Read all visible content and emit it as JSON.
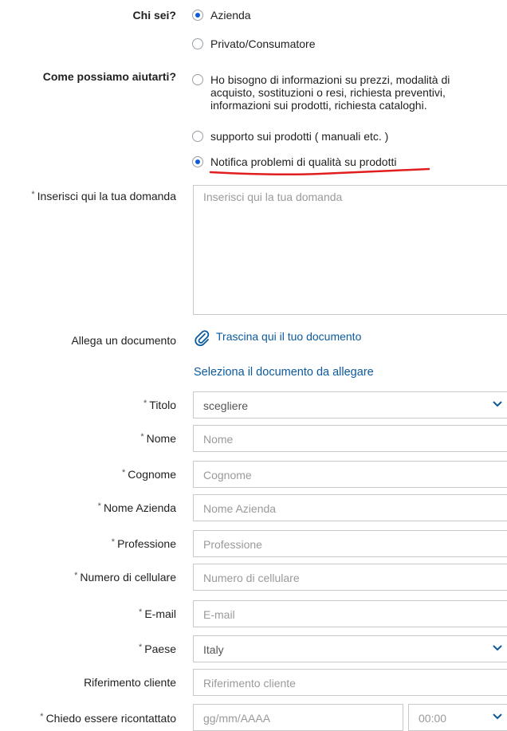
{
  "who": {
    "label": "Chi sei?",
    "options": [
      "Azienda",
      "Privato/Consumatore"
    ],
    "selected": "Azienda"
  },
  "help": {
    "label": "Come possiamo aiutarti?",
    "options": [
      "Ho bisogno di informazioni su prezzi, modalità di acquisto, sostituzioni o resi, richiesta preventivi, informazioni sui prodotti, richiesta cataloghi.",
      "supporto sui prodotti ( manuali etc. )",
      "Notifica problemi di qualità su prodotti"
    ],
    "selected": "Notifica problemi di qualità su prodotti"
  },
  "question": {
    "label": "Inserisci qui la tua domanda",
    "placeholder": "Inserisci qui la tua domanda"
  },
  "attach": {
    "label": "Allega un documento",
    "drop_text": "Trascina qui il tuo documento",
    "select_link": "Seleziona il documento da allegare"
  },
  "fields": {
    "titolo": {
      "label": "Titolo",
      "value": "scegliere"
    },
    "nome": {
      "label": "Nome",
      "placeholder": "Nome"
    },
    "cognome": {
      "label": "Cognome",
      "placeholder": "Cognome"
    },
    "azienda": {
      "label": "Nome Azienda",
      "placeholder": "Nome Azienda"
    },
    "professione": {
      "label": "Professione",
      "placeholder": "Professione"
    },
    "cellulare": {
      "label": "Numero di cellulare",
      "placeholder": "Numero di cellulare"
    },
    "email": {
      "label": "E-mail",
      "placeholder": "E-mail"
    },
    "paese": {
      "label": "Paese",
      "value": "Italy"
    },
    "riferimento": {
      "label": "Riferimento cliente",
      "placeholder": "Riferimento cliente"
    },
    "ricontatto": {
      "label": "Chiedo essere ricontattato",
      "date_placeholder": "gg/mm/AAAA",
      "time_value": "00:00"
    }
  },
  "required_mark": "*",
  "colors": {
    "accent": "#0b5ed7",
    "link": "#0b5a9e",
    "annotation": "#e11d1d"
  }
}
